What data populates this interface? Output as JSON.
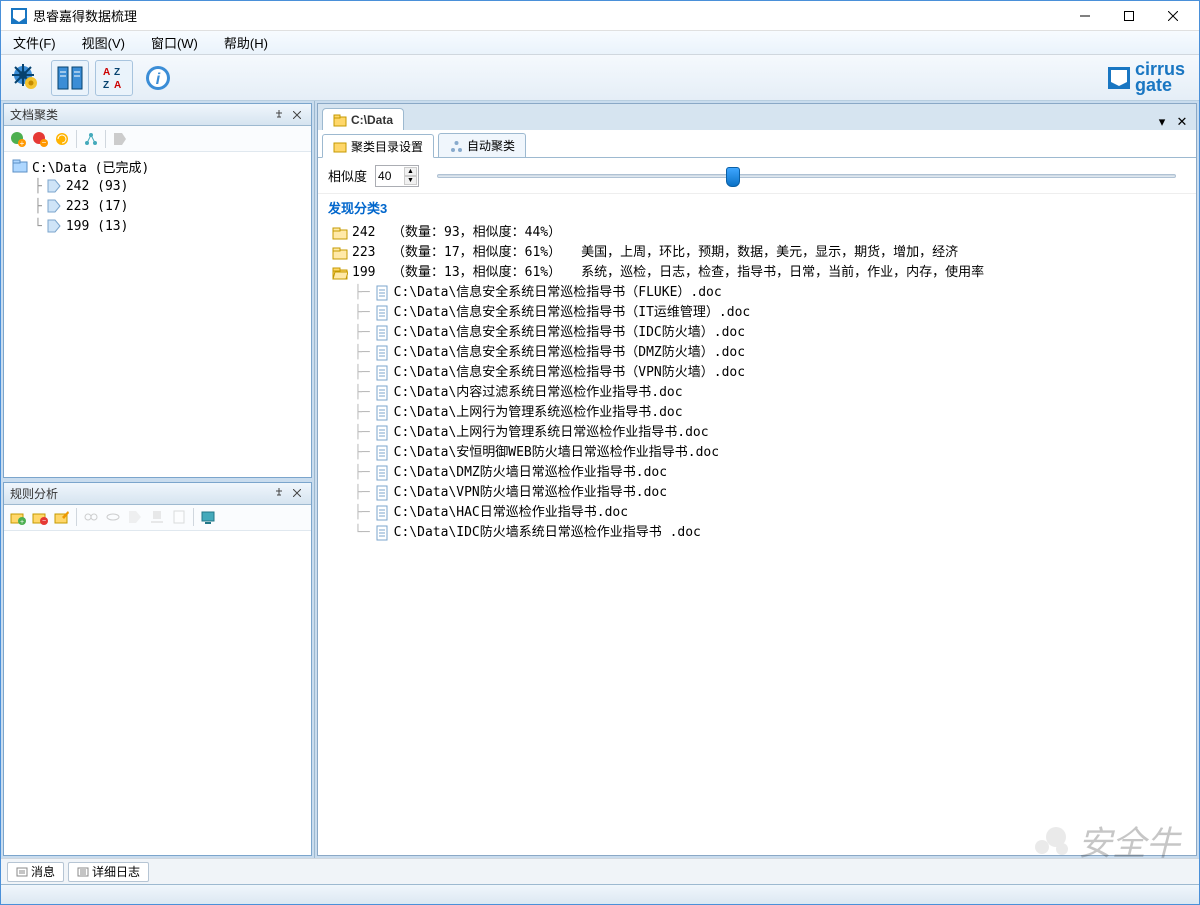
{
  "title": "思睿嘉得数据梳理",
  "menu": {
    "file": "文件(F)",
    "view": "视图(V)",
    "window": "窗口(W)",
    "help": "帮助(H)"
  },
  "brand": {
    "name1": "cirrus",
    "name2": "gate"
  },
  "leftPanel": {
    "title": "文档聚类",
    "tree": {
      "root": "C:\\Data (已完成)",
      "children": [
        {
          "label": "242 (93)"
        },
        {
          "label": "223 (17)"
        },
        {
          "label": "199 (13)"
        }
      ]
    }
  },
  "rulePanel": {
    "title": "规则分析"
  },
  "mainTab": {
    "label": "C:\\Data"
  },
  "subtabs": {
    "dir": "聚类目录设置",
    "auto": "自动聚类"
  },
  "similarity": {
    "label": "相似度",
    "value": "40",
    "sliderPct": 40
  },
  "found": {
    "header": "发现分类3"
  },
  "clusters": [
    {
      "id": "242",
      "meta": "（数量：93，相似度：44%）",
      "keywords": "",
      "open": false
    },
    {
      "id": "223",
      "meta": "（数量：17，相似度：61%）",
      "keywords": "美国，上周，环比，预期，数据，美元，显示，期货，增加，经济",
      "open": false
    },
    {
      "id": "199",
      "meta": "（数量：13，相似度：61%）",
      "keywords": "系统，巡检，日志，检查，指导书，日常，当前，作业，内存，使用率",
      "open": true
    }
  ],
  "files": [
    "C:\\Data\\信息安全系统日常巡检指导书（FLUKE）.doc",
    "C:\\Data\\信息安全系统日常巡检指导书（IT运维管理）.doc",
    "C:\\Data\\信息安全系统日常巡检指导书（IDC防火墙）.doc",
    "C:\\Data\\信息安全系统日常巡检指导书（DMZ防火墙）.doc",
    "C:\\Data\\信息安全系统日常巡检指导书（VPN防火墙）.doc",
    "C:\\Data\\内容过滤系统日常巡检作业指导书.doc",
    "C:\\Data\\上网行为管理系统巡检作业指导书.doc",
    "C:\\Data\\上网行为管理系统日常巡检作业指导书.doc",
    "C:\\Data\\安恒明御WEB防火墙日常巡检作业指导书.doc",
    "C:\\Data\\DMZ防火墙日常巡检作业指导书.doc",
    "C:\\Data\\VPN防火墙日常巡检作业指导书.doc",
    "C:\\Data\\HAC日常巡检作业指导书.doc",
    "C:\\Data\\IDC防火墙系统日常巡检作业指导书 .doc"
  ],
  "bottomTabs": {
    "msg": "消息",
    "log": "详细日志"
  },
  "watermark": "安全牛"
}
